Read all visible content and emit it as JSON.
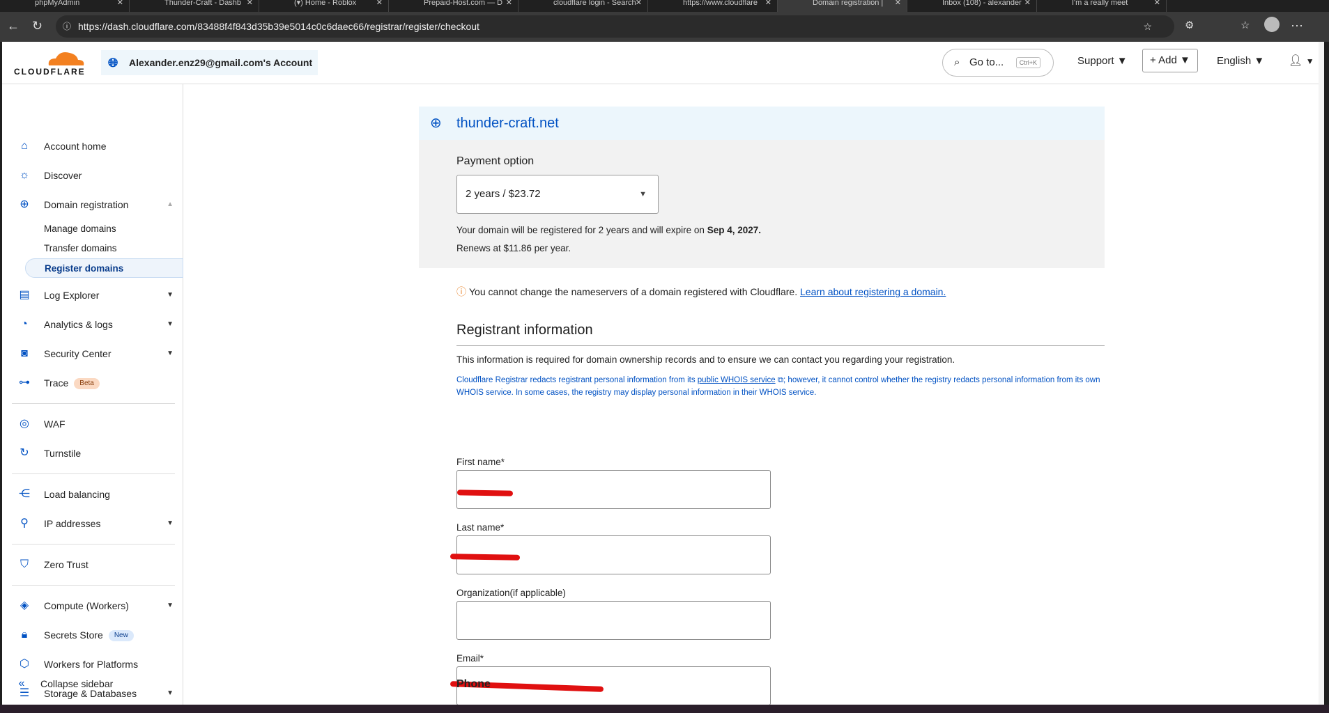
{
  "browser": {
    "tabs": [
      "phpMyAdmin",
      "Thunder-Craft - Dashb",
      "(▾) Home - Roblox",
      "Prepaid-Host.com — D",
      "cloudflare login - Search",
      "https://www.cloudflare",
      "Domain registration | ",
      "Inbox (108) - alexander",
      "I'm a really meet"
    ],
    "active_tab": 6,
    "url": "https://dash.cloudflare.com/83488f4f843d35b39e5014c0c6daec66/registrar/register/checkout"
  },
  "header": {
    "logo": "CLOUDFLARE",
    "account": "Alexander.enz29@gmail.com's Account",
    "goto": "Go to...",
    "goto_shortcut": "Ctrl+K",
    "support": "Support",
    "add": "Add",
    "language": "English"
  },
  "sidebar": {
    "items": [
      {
        "label": "Account home",
        "icon": "home-icon"
      },
      {
        "label": "Discover",
        "icon": "lightbulb-icon"
      },
      {
        "label": "Domain registration",
        "icon": "globe-icon"
      },
      {
        "label": "Log Explorer",
        "icon": "document-icon"
      },
      {
        "label": "Analytics & logs",
        "icon": "chart-icon"
      },
      {
        "label": "Security Center",
        "icon": "shield-icon"
      },
      {
        "label": "Trace",
        "icon": "trace-icon",
        "badge": "Beta"
      },
      {
        "label": "WAF",
        "icon": "waf-icon"
      },
      {
        "label": "Turnstile",
        "icon": "turnstile-icon"
      },
      {
        "label": "Load balancing",
        "icon": "load-balancing-icon"
      },
      {
        "label": "IP addresses",
        "icon": "location-icon"
      },
      {
        "label": "Zero Trust",
        "icon": "zero-trust-icon"
      },
      {
        "label": "Compute (Workers)",
        "icon": "workers-icon"
      },
      {
        "label": "Secrets Store",
        "icon": "lock-icon",
        "badge": "New"
      },
      {
        "label": "Workers for Platforms",
        "icon": "cube-icon"
      },
      {
        "label": "Storage & Databases",
        "icon": "database-icon"
      }
    ],
    "sub": [
      "Manage domains",
      "Transfer domains",
      "Register domains"
    ],
    "collapse": "Collapse sidebar"
  },
  "main": {
    "domain": "thunder-craft.net",
    "payment_label": "Payment option",
    "payment_value": "2 years / $23.72",
    "expire_text": "Your domain will be registered for 2 years and will expire on ",
    "expire_date": "Sep 4, 2027.",
    "renew": "Renews at $11.86 per year.",
    "warning": "You cannot change the nameservers of a domain registered with Cloudflare.",
    "warning_link": "Learn about registering a domain.",
    "section_title": "Registrant information",
    "info": "This information is required for domain ownership records and to ensure we can contact you regarding your registration.",
    "note_a": "Cloudflare Registrar redacts registrant personal information from its ",
    "note_link": "public WHOIS service",
    "note_b": "; however, it cannot control whether the registry redacts personal information from its own WHOIS service. In some cases, the registry may display personal information in their WHOIS service.",
    "fields": [
      "First name*",
      "Last name*",
      "Organization(if applicable)",
      "Email*"
    ],
    "phone": "Phone"
  }
}
